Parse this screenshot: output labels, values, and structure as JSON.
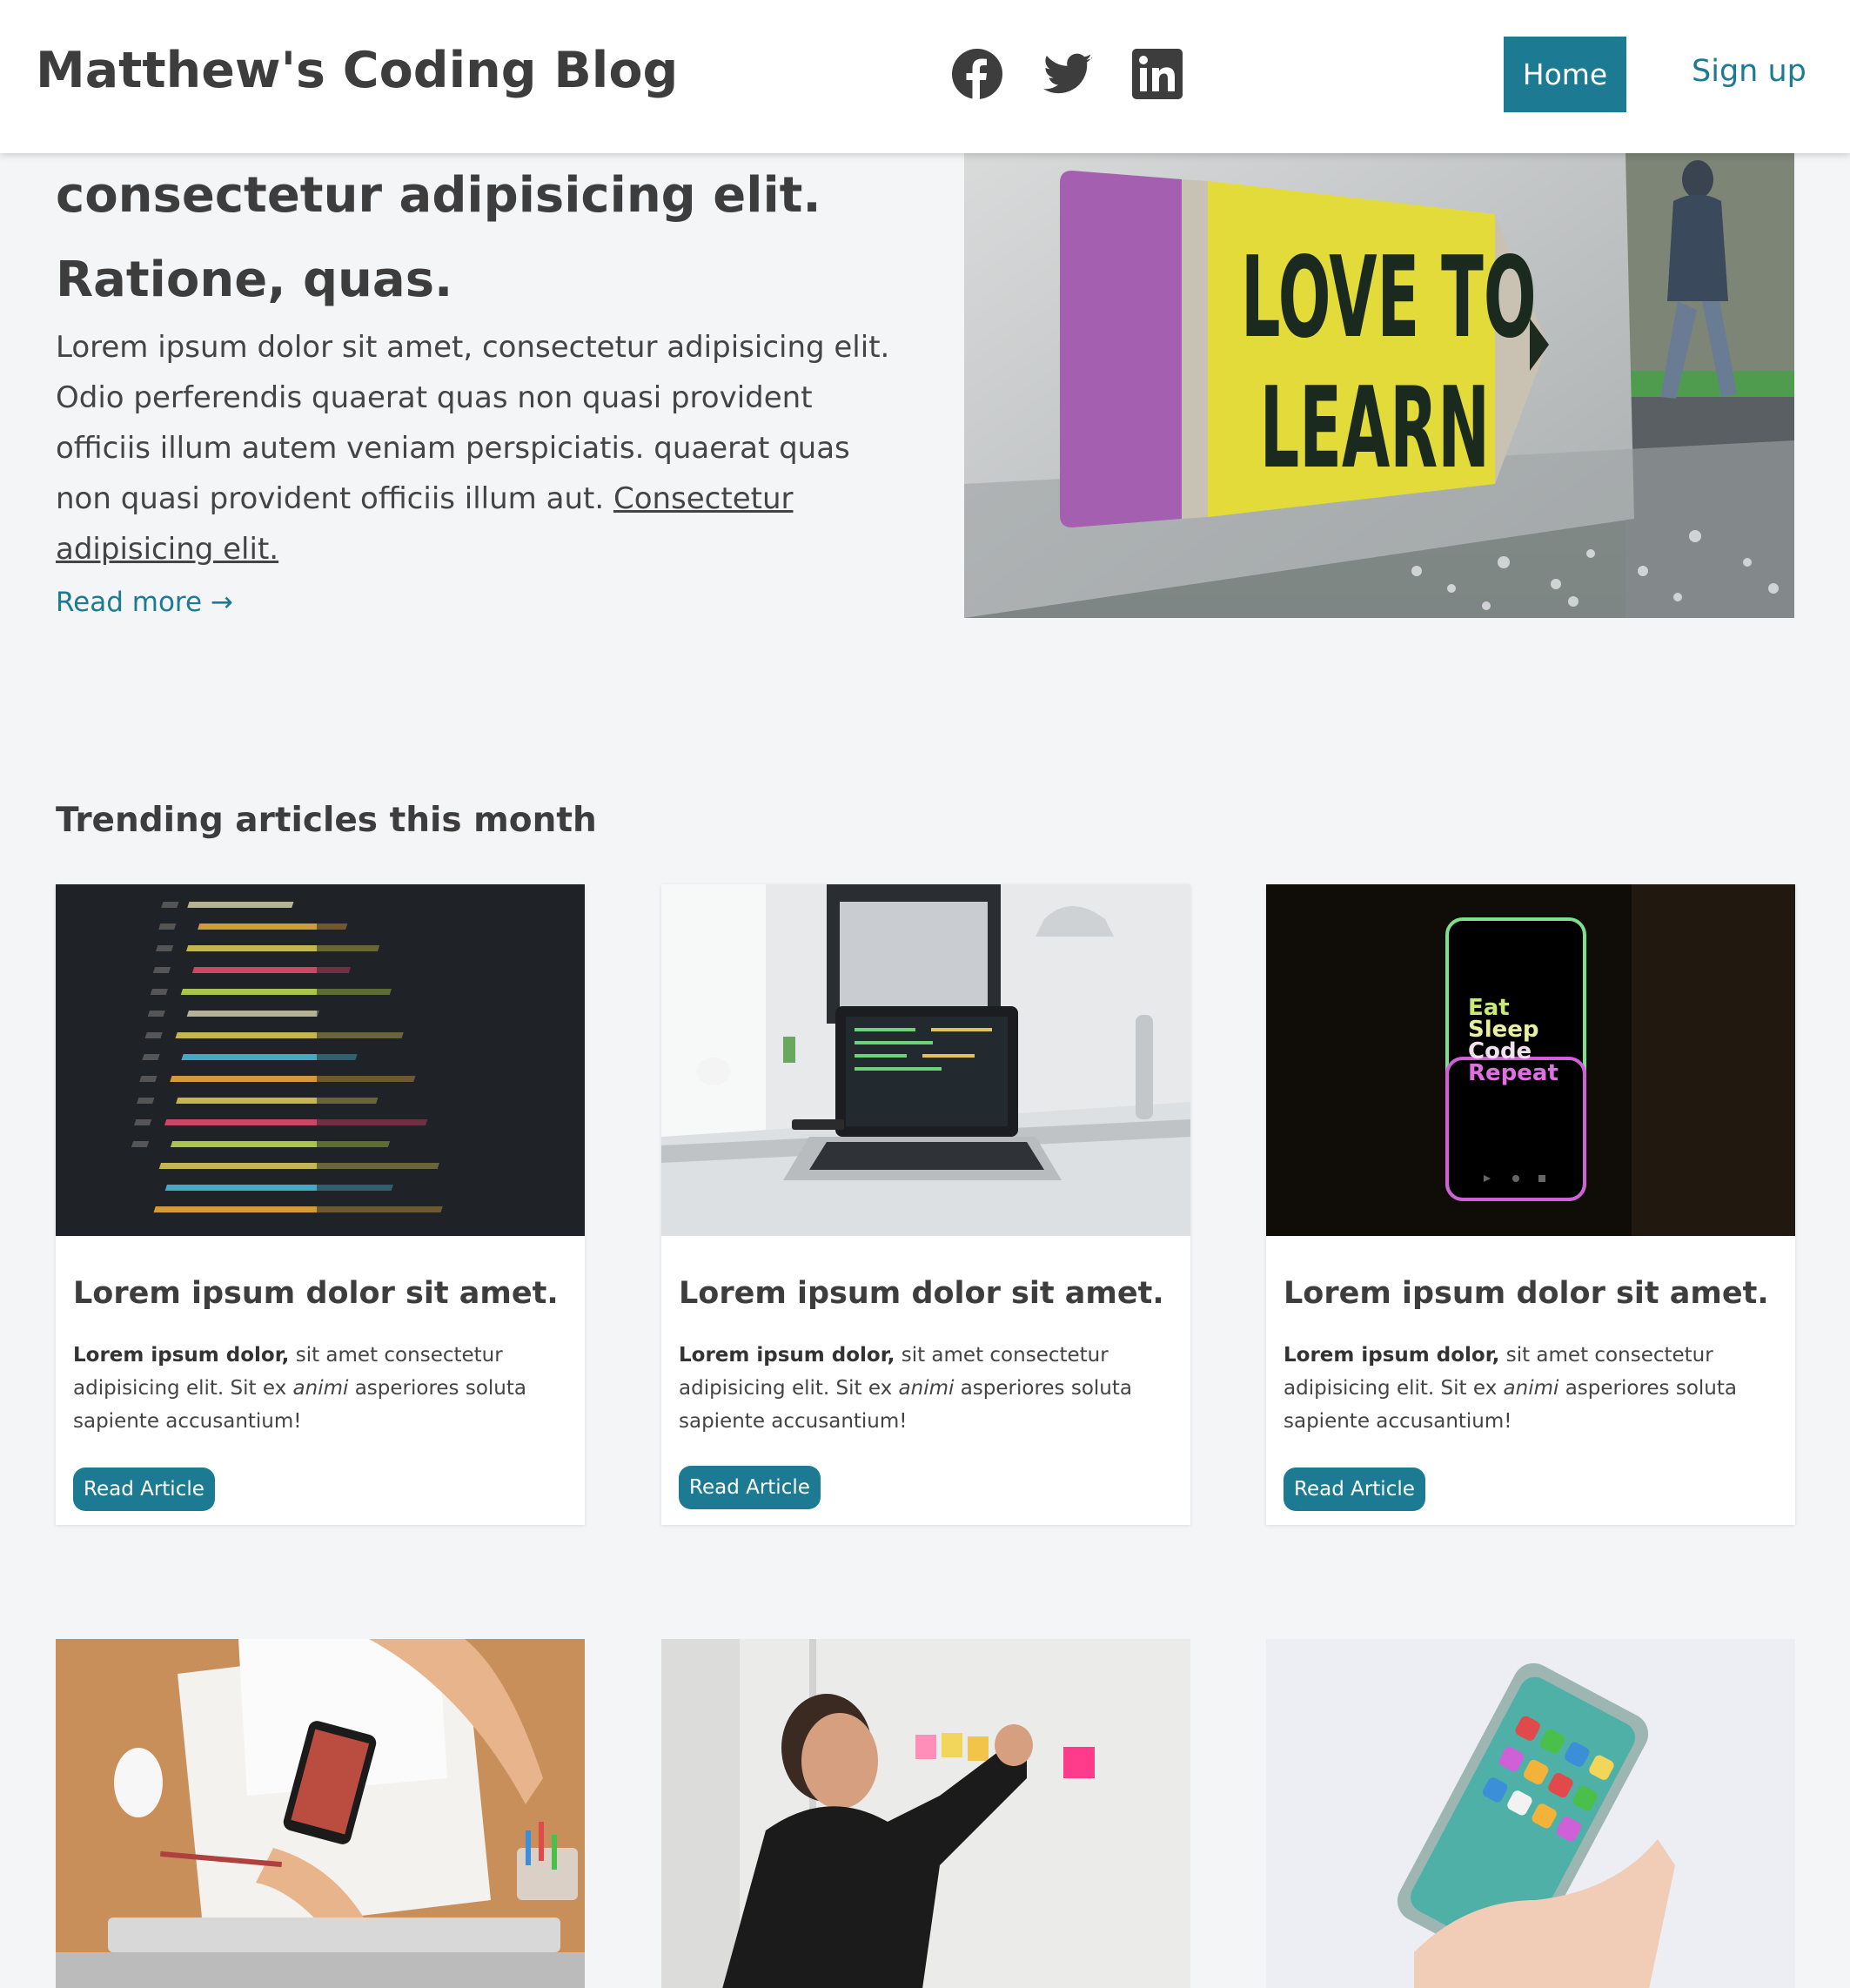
{
  "header": {
    "brand": "Matthew's Coding Blog",
    "social_icons": [
      "facebook-icon",
      "twitter-icon",
      "linkedin-icon"
    ],
    "nav": {
      "home": "Home",
      "signup": "Sign up"
    }
  },
  "hero": {
    "title_lines": [
      "consectetur adipisicing elit.",
      "Ratione, quas."
    ],
    "text": "Lorem ipsum dolor sit amet, consectetur adipisicing elit. Odio perferendis quaerat quas non quasi provident officiis illum autem veniam perspiciatis. quaerat quas non quasi provident officiis illum aut.",
    "link": "Consectetur adipisicing elit.",
    "read_more": "Read more →",
    "image_sign_text": [
      "LOVE TO",
      "LEARN"
    ]
  },
  "trending": {
    "title": "Trending articles this month",
    "cards": [
      {
        "title": "Lorem ipsum dolor sit amet.",
        "text_bold": "Lorem ipsum dolor,",
        "text_1": " sit amet consectetur adipisicing elit. Sit ex ",
        "text_italic": "animi",
        "text_2": " asperiores soluta sapiente accusantium!",
        "button": "Read Article"
      },
      {
        "title": "Lorem ipsum dolor sit amet.",
        "text_bold": "Lorem ipsum dolor,",
        "text_1": " sit amet consectetur adipisicing elit. Sit ex ",
        "text_italic": "animi",
        "text_2": " asperiores soluta sapiente accusantium!",
        "button": "Read Article"
      },
      {
        "title": "Lorem ipsum dolor sit amet.",
        "text_bold": "Lorem ipsum dolor,",
        "text_1": " sit amet consectetur adipisicing elit. Sit ex ",
        "text_italic": "animi",
        "text_2": " asperiores soluta sapiente accusantium!",
        "button": "Read Article"
      }
    ],
    "phone_text": [
      "Eat",
      "Sleep",
      "Code",
      "Repeat"
    ]
  },
  "colors": {
    "accent": "#1c7b93",
    "background": "#f4f5f7",
    "heading": "#3d3d3d"
  }
}
